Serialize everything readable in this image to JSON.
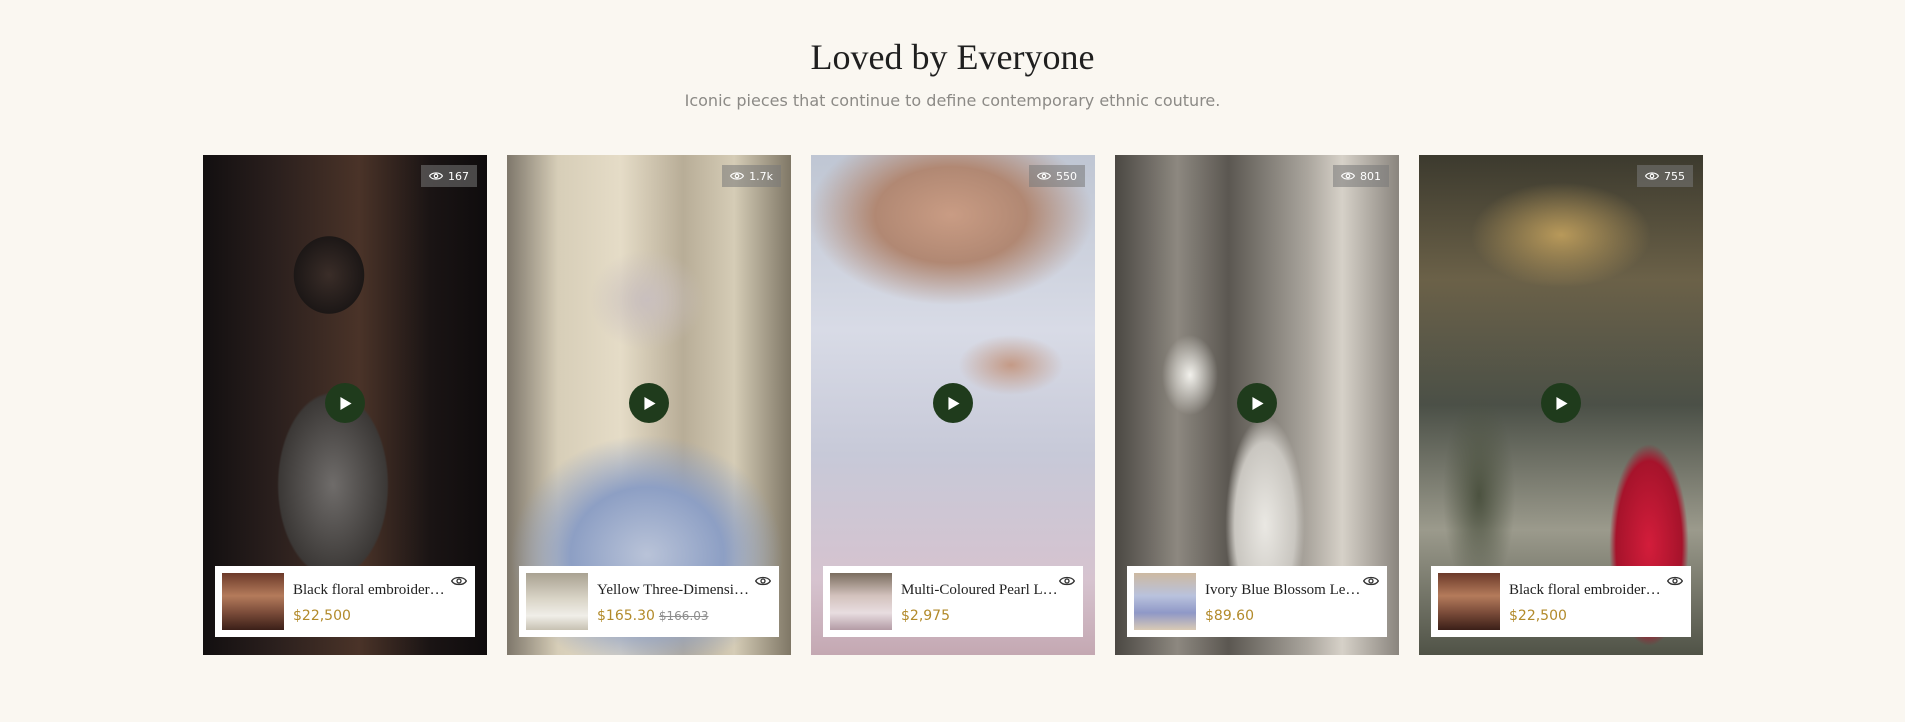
{
  "section": {
    "title": "Loved by Everyone",
    "subtitle": "Iconic pieces that continue to define contemporary ethnic couture."
  },
  "colors": {
    "background": "#faf7f1",
    "play_button": "#1f3b1c",
    "price": "#b28a2a"
  },
  "cards": [
    {
      "views": "167",
      "product_name": "Black floral embroidered blouse",
      "price": "$22,500",
      "old_price": "",
      "icons": [
        "eye-icon",
        "play-icon",
        "quick-view-icon"
      ]
    },
    {
      "views": "1.7k",
      "product_name": "Yellow Three-Dimensional Lehenga",
      "price": "$165.30",
      "old_price": "$166.03",
      "icons": [
        "eye-icon",
        "play-icon",
        "quick-view-icon"
      ]
    },
    {
      "views": "550",
      "product_name": "Multi-Coloured Pearl Lehenga",
      "price": "$2,975",
      "old_price": "",
      "icons": [
        "eye-icon",
        "play-icon",
        "quick-view-icon"
      ]
    },
    {
      "views": "801",
      "product_name": "Ivory Blue Blossom Lehenga",
      "price": "$89.60",
      "old_price": "",
      "icons": [
        "eye-icon",
        "play-icon",
        "quick-view-icon"
      ]
    },
    {
      "views": "755",
      "product_name": "Black floral embroidered blouse",
      "price": "$22,500",
      "old_price": "",
      "icons": [
        "eye-icon",
        "play-icon",
        "quick-view-icon"
      ]
    }
  ]
}
